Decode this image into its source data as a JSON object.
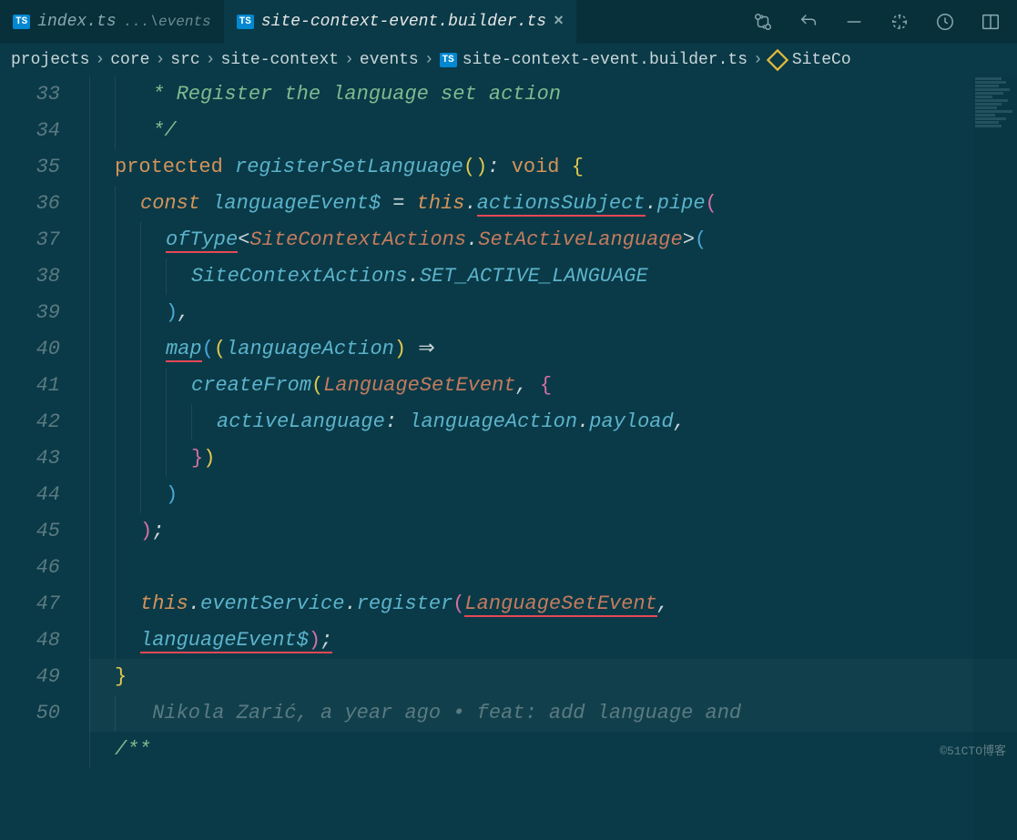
{
  "tabs": {
    "inactive": {
      "label": "index.ts",
      "suffix": "...\\events"
    },
    "active": {
      "label": "site-context-event.builder.ts"
    }
  },
  "breadcrumb": {
    "b0": "projects",
    "b1": "core",
    "b2": "src",
    "b3": "site-context",
    "b4": "events",
    "b5": "site-context-event.builder.ts",
    "b6": "SiteCo"
  },
  "lines": {
    "n33": "33",
    "n34": "34",
    "n35": "35",
    "n36": "36",
    "n37": "37",
    "n38": "38",
    "n39": "39",
    "n40": "40",
    "n41": "41",
    "n42": "42",
    "n43": "43",
    "n44": "44",
    "n45": "45",
    "n46": "46",
    "n47": "47",
    "n48": "48",
    "n49": "49",
    "n50": "50"
  },
  "code": {
    "l33": " * Register the language set action",
    "l34": " */",
    "kw_protected": "protected",
    "fn_register": "registerSetLanguage",
    "kw_void": "void",
    "kw_const": "const",
    "var_lang": "languageEvent$",
    "kw_this1": "this",
    "m_actionsSubject": "actionsSubject",
    "m_pipe": "pipe",
    "fn_ofType": "ofType",
    "t_sca": "SiteContextActions",
    "t_sal": "SetActiveLanguage",
    "c_sca": "SiteContextActions",
    "c_sal": "SET_ACTIVE_LANGUAGE",
    "fn_map": "map",
    "p_langAction": "languageAction",
    "fn_createFrom": "createFrom",
    "t_lse": "LanguageSetEvent",
    "prop_active": "activeLanguage",
    "m_payload": "payload",
    "kw_this2": "this",
    "m_eventService": "eventService",
    "m_register": "register",
    "t_lse2": "LanguageSetEvent",
    "v_langEvent": "languageEvent$",
    "blame": "Nikola Zarić, a year ago • feat: add language and",
    "l50": "/**"
  },
  "watermark": "©51CTO博客"
}
